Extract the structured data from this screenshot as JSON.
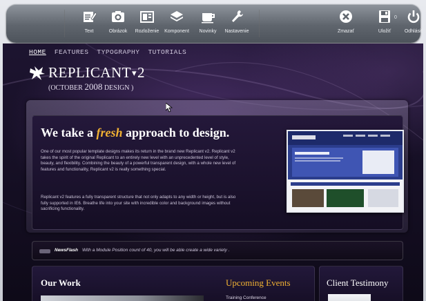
{
  "toolbar": {
    "items": [
      {
        "label": "Text",
        "icon": "text-edit-icon"
      },
      {
        "label": "Obrázok",
        "icon": "camera-icon"
      },
      {
        "label": "Rozloženie",
        "icon": "layout-icon"
      },
      {
        "label": "Komponent",
        "icon": "component-icon"
      },
      {
        "label": "Novinky",
        "icon": "news-icon"
      },
      {
        "label": "Nastavenie",
        "icon": "wrench-icon"
      }
    ],
    "right_items": [
      {
        "label": "Zmazať",
        "icon": "delete-icon"
      },
      {
        "label": "Uložiť",
        "icon": "save-icon"
      },
      {
        "label": "Odhlásiť",
        "icon": "power-icon"
      }
    ],
    "save_badge": "0"
  },
  "site": {
    "nav": [
      "HOME",
      "FEATURES",
      "TYPOGRAPHY",
      "TUTORIALS"
    ],
    "logo": {
      "name": "REPLICANT",
      "version": "2",
      "subtitle_prefix": "(OCTOBER ",
      "subtitle_year": "2008",
      "subtitle_suffix": " DESIGN )"
    },
    "hero": {
      "title_before": "We take a ",
      "title_highlight": "fresh",
      "title_after": " approach to design.",
      "paragraph1": "One of our most popular template designs makes its return in the brand new Replicant v2. Replicant v2 takes the spirit of the original Replicant to an entirely new level with an unprecedented level of style, beauty, and flexibility. Combining the beauty of a powerful transparent design, with a whole new level of features and functionality, Replicant v2 is really something special.",
      "paragraph2": "Replicant v2 features a fully transparent structure that not only adapts to any width or height, but is also fully supported in IE6. Breathe life into your site with incredible color and background images without sacrificing functionality."
    },
    "newsflash": {
      "label": "NewsFlash",
      "text": "With a Module Position count of 40, you will be able create a wide variety ."
    },
    "boxes": {
      "our_work": "Our Work",
      "upcoming_events": "Upcoming Events",
      "event_item": "Training Conference",
      "client_testimony": "Client Testimony"
    }
  },
  "colors": {
    "accent": "#f2b233",
    "toolbar": "#5f656d",
    "background": "#140e22"
  }
}
